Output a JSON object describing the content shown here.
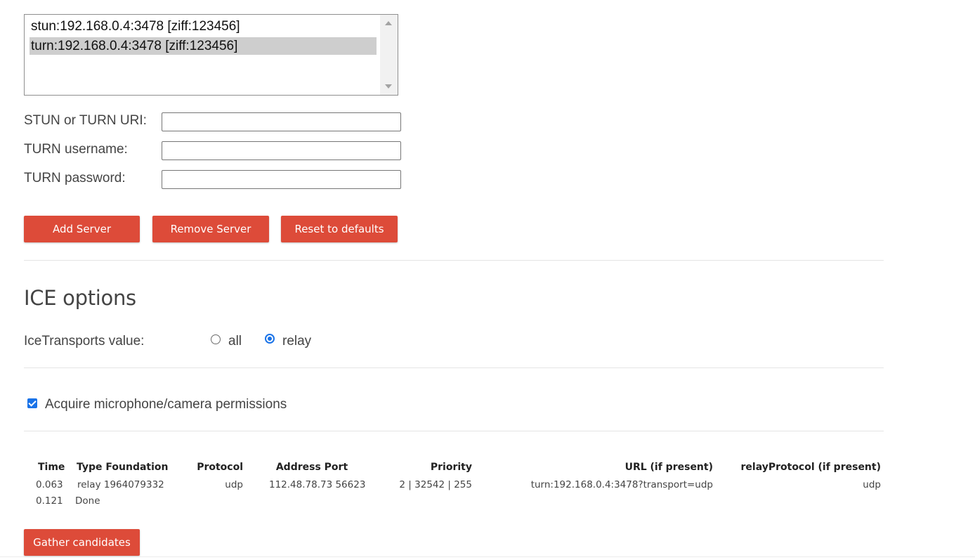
{
  "servers": {
    "items": [
      {
        "label": "stun:192.168.0.4:3478 [ziff:123456]",
        "selected": false
      },
      {
        "label": "turn:192.168.0.4:3478 [ziff:123456]",
        "selected": true
      }
    ]
  },
  "form": {
    "uri_label": "STUN or TURN URI:",
    "uri_value": "",
    "username_label": "TURN username:",
    "username_value": "",
    "password_label": "TURN password:",
    "password_value": ""
  },
  "buttons": {
    "add": "Add Server",
    "remove": "Remove Server",
    "reset": "Reset to defaults",
    "gather": "Gather candidates"
  },
  "ice": {
    "title": "ICE options",
    "transports_label": "IceTransports value:",
    "options": [
      {
        "label": "all",
        "checked": false
      },
      {
        "label": "relay",
        "checked": true
      }
    ]
  },
  "permissions": {
    "label": "Acquire microphone/camera permissions",
    "checked": true
  },
  "candidates": {
    "headers": {
      "time": "Time",
      "type_foundation": "Type Foundation",
      "protocol": "Protocol",
      "address_port": "Address Port",
      "priority": "Priority",
      "url": "URL (if present)",
      "relay_protocol": "relayProtocol (if present)"
    },
    "rows": [
      {
        "time": "0.063",
        "type_foundation": "relay 1964079332",
        "protocol": "udp",
        "address_port": "112.48.78.73 56623",
        "priority": "2 | 32542 | 255",
        "url": "turn:192.168.0.4:3478?transport=udp",
        "relay_protocol": "udp"
      },
      {
        "time": "0.121",
        "type_foundation": "Done"
      }
    ]
  },
  "colors": {
    "button": "#dd4b39",
    "selection": "#cecece",
    "accent": "#1a73e8"
  }
}
